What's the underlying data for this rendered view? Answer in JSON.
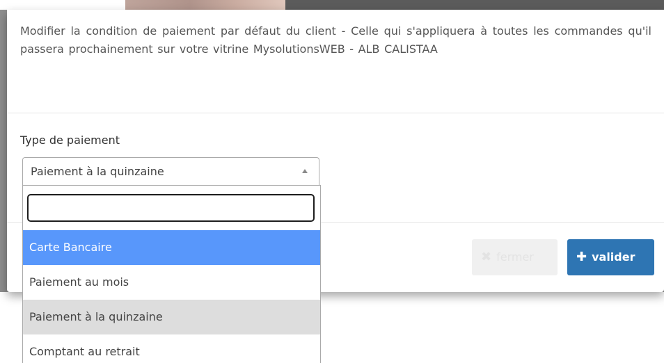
{
  "modal": {
    "header_text": "Modifier la condition de paiement par défaut du client - Celle qui s'appliquera à toutes les commandes qu'il passera prochainement sur votre vitrine MysolutionsWEB - ALB CALISTAA",
    "field_label": "Type de paiement",
    "selected_value": "Paiement à la quinzaine",
    "buttons": {
      "close_label": "fermer",
      "validate_label": "valider",
      "validate_color": "#2e75b3"
    }
  },
  "dropdown": {
    "search_value": "",
    "options": [
      {
        "label": "Carte Bancaire",
        "state": "highlighted"
      },
      {
        "label": "Paiement au mois",
        "state": "normal"
      },
      {
        "label": "Paiement à la quinzaine",
        "state": "selected"
      },
      {
        "label": "Comptant au retrait",
        "state": "normal"
      }
    ],
    "highlight_color": "#5897fb"
  },
  "icons": {
    "close": "close-icon",
    "validate": "plus-icon",
    "select_arrow": "caret-up-icon"
  }
}
